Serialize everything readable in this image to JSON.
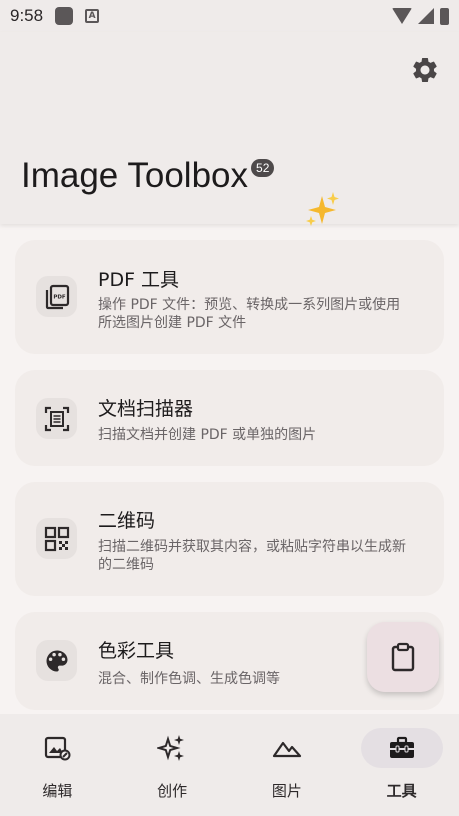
{
  "status_bar": {
    "time": "9:58",
    "notification_letter": "A"
  },
  "header": {
    "title": "Image Toolbox",
    "version_badge": "52",
    "settings_icon": "gear-icon",
    "sparkle_icon": "sparkles-icon"
  },
  "tools": [
    {
      "title": "PDF 工具",
      "description": "操作 PDF 文件：预览、转换成一系列图片或使用所选图片创建 PDF 文件",
      "icon": "pdf-icon"
    },
    {
      "title": "文档扫描器",
      "description": "扫描文档并创建 PDF 或单独的图片",
      "icon": "document-scanner-icon"
    },
    {
      "title": "二维码",
      "description": "扫描二维码并获取其内容，或粘贴字符串以生成新的二维码",
      "icon": "qr-code-icon"
    },
    {
      "title": "色彩工具",
      "description": "混合、制作色调、生成色调等",
      "icon": "palette-icon"
    }
  ],
  "fab": {
    "icon": "clipboard-icon"
  },
  "bottom_nav": {
    "items": [
      {
        "label": "编辑",
        "icon": "image-edit-icon"
      },
      {
        "label": "创作",
        "icon": "sparkles-create-icon"
      },
      {
        "label": "图片",
        "icon": "landscape-icon"
      },
      {
        "label": "工具",
        "icon": "toolbox-icon",
        "active": true
      }
    ]
  },
  "colors": {
    "background": "#f7f3f2",
    "card": "#f1ecea",
    "fab": "#ecdfe2",
    "active_nav": "#e4dfe3"
  }
}
